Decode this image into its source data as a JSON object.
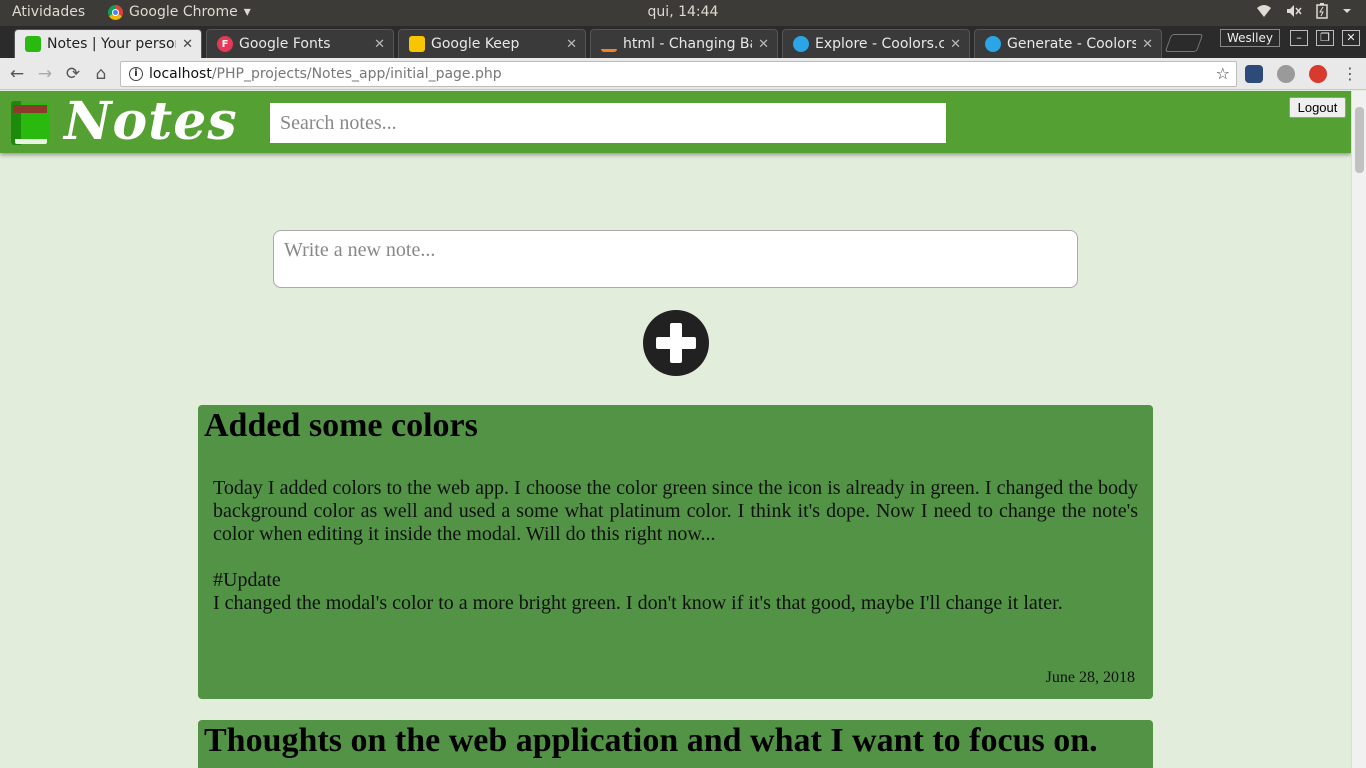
{
  "system_bar": {
    "activities": "Atividades",
    "app_name": "Google Chrome",
    "app_menu_arrow": "▾",
    "clock": "qui, 14:44",
    "tray_icons": [
      "wifi-icon",
      "volume-muted-icon",
      "battery-icon",
      "power-menu-arrow-icon"
    ]
  },
  "browser": {
    "tabs": [
      {
        "title": "Notes | Your personal notes",
        "favicon": "notes-favicon",
        "color": "#29b90f",
        "active": true
      },
      {
        "title": "Google Fonts",
        "favicon": "google-fonts-favicon",
        "color": "#e63956",
        "letter": "F",
        "active": false
      },
      {
        "title": "Google Keep",
        "favicon": "google-keep-favicon",
        "color": "#f7c600",
        "active": false
      },
      {
        "title": "html - Changing Background",
        "favicon": "stackoverflow-favicon",
        "color": "#f48024",
        "active": false
      },
      {
        "title": "Explore - Coolors.co",
        "favicon": "coolors-favicon",
        "color": "#2aa5e6",
        "active": false
      },
      {
        "title": "Generate - Coolors.co",
        "favicon": "coolors-favicon",
        "color": "#2aa5e6",
        "active": false
      }
    ],
    "profile_name": "Weslley",
    "window_controls": [
      "minimize-icon",
      "restore-icon",
      "close-icon"
    ],
    "nav": {
      "back": "←",
      "forward": "→",
      "reload": "⟳",
      "home": "⌂"
    },
    "url_host": "localhost",
    "url_path": "/PHP_projects/Notes_app/initial_page.php",
    "bookmark_icon": "☆",
    "extensions": [
      "ghostery-icon",
      "extension-icon",
      "adblock-icon",
      "chrome-menu-icon"
    ]
  },
  "header": {
    "brand": "Notes",
    "search_placeholder": "Search notes...",
    "logout_label": "Logout"
  },
  "composer": {
    "placeholder": "Write a new note...",
    "add_icon": "plus-circle-icon"
  },
  "notes": [
    {
      "title": "Added some colors",
      "paragraphs": [
        "Today I added colors to the web app. I choose the color green since the icon is already in green. I changed the body background color as well and used a some what platinum color. I think it's dope. Now I need to change the note's color when editing it inside the modal. Will do this right now...",
        "",
        "#Update",
        "I changed the modal's color to a more bright green. I don't know if it's that good, maybe I'll change it later."
      ],
      "date": "June 28, 2018"
    },
    {
      "title": "Thoughts on the web application and what I want to focus on.",
      "paragraphs": [],
      "date": ""
    }
  ],
  "colors": {
    "header_green": "#55a033",
    "note_green": "#529345",
    "page_background": "#e3eddb",
    "add_button": "#212121"
  }
}
